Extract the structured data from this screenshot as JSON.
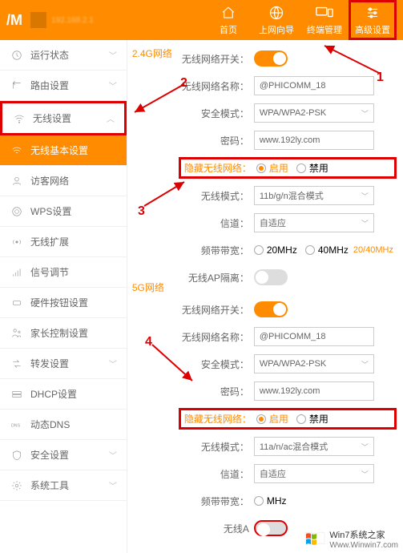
{
  "header": {
    "logo": "/M",
    "ip": "192.168.2.1",
    "nav": [
      {
        "label": "首页",
        "icon": "home"
      },
      {
        "label": "上网向导",
        "icon": "globe"
      },
      {
        "label": "终端管理",
        "icon": "devices"
      },
      {
        "label": "高级设置",
        "icon": "sliders"
      }
    ]
  },
  "sidebar": {
    "items": [
      {
        "label": "运行状态",
        "icon": "status",
        "chev": "down"
      },
      {
        "label": "路由设置",
        "icon": "route",
        "chev": "down"
      },
      {
        "label": "无线设置",
        "icon": "wifi",
        "chev": "up",
        "highlight": true
      },
      {
        "label": "无线基本设置",
        "icon": "wifi",
        "sub": true
      },
      {
        "label": "访客网络",
        "icon": "guest"
      },
      {
        "label": "WPS设置",
        "icon": "wps"
      },
      {
        "label": "无线扩展",
        "icon": "extend"
      },
      {
        "label": "信号调节",
        "icon": "signal"
      },
      {
        "label": "硬件按钮设置",
        "icon": "button"
      },
      {
        "label": "家长控制设置",
        "icon": "parent"
      },
      {
        "label": "转发设置",
        "icon": "forward",
        "chev": "down"
      },
      {
        "label": "DHCP设置",
        "icon": "dhcp"
      },
      {
        "label": "动态DNS",
        "icon": "dns"
      },
      {
        "label": "安全设置",
        "icon": "security",
        "chev": "down"
      },
      {
        "label": "系统工具",
        "icon": "tools",
        "chev": "down"
      }
    ]
  },
  "main": {
    "band24": {
      "title": "2.4G网络",
      "switch_label": "无线网络开关：",
      "name_label": "无线网络名称：",
      "name_value": "@PHICOMM_18",
      "sec_label": "安全模式：",
      "sec_value": "WPA/WPA2-PSK",
      "pwd_label": "密码：",
      "pwd_value": "www.192ly.com",
      "hide_label": "隐藏无线网络：",
      "hide_on": "启用",
      "hide_off": "禁用",
      "mode_label": "无线模式：",
      "mode_value": "11b/g/n混合模式",
      "channel_label": "信道：",
      "channel_value": "自适应",
      "bw_label": "频带带宽：",
      "bw_20": "20MHz",
      "bw_40": "40MHz",
      "bw_ext": "20/40MHz",
      "ap_label": "无线AP隔离："
    },
    "band5": {
      "title": "5G网络",
      "switch_label": "无线网络开关：",
      "name_label": "无线网络名称：",
      "name_value": "@PHICOMM_18",
      "sec_label": "安全模式：",
      "sec_value": "WPA/WPA2-PSK",
      "pwd_label": "密码：",
      "pwd_value": "www.192ly.com",
      "hide_label": "隐藏无线网络：",
      "hide_on": "启用",
      "hide_off": "禁用",
      "mode_label": "无线模式：",
      "mode_value": "11a/n/ac混合模式",
      "channel_label": "信道：",
      "channel_value": "自适应",
      "bw_label": "频带带宽：",
      "bw_v": "MHz",
      "ap_label": "无线A"
    }
  },
  "annotations": {
    "a1": "1",
    "a2": "2",
    "a3": "3",
    "a4": "4"
  },
  "watermark": {
    "line1": "Win7系统之家",
    "line2": "Www.Winwin7.com"
  }
}
